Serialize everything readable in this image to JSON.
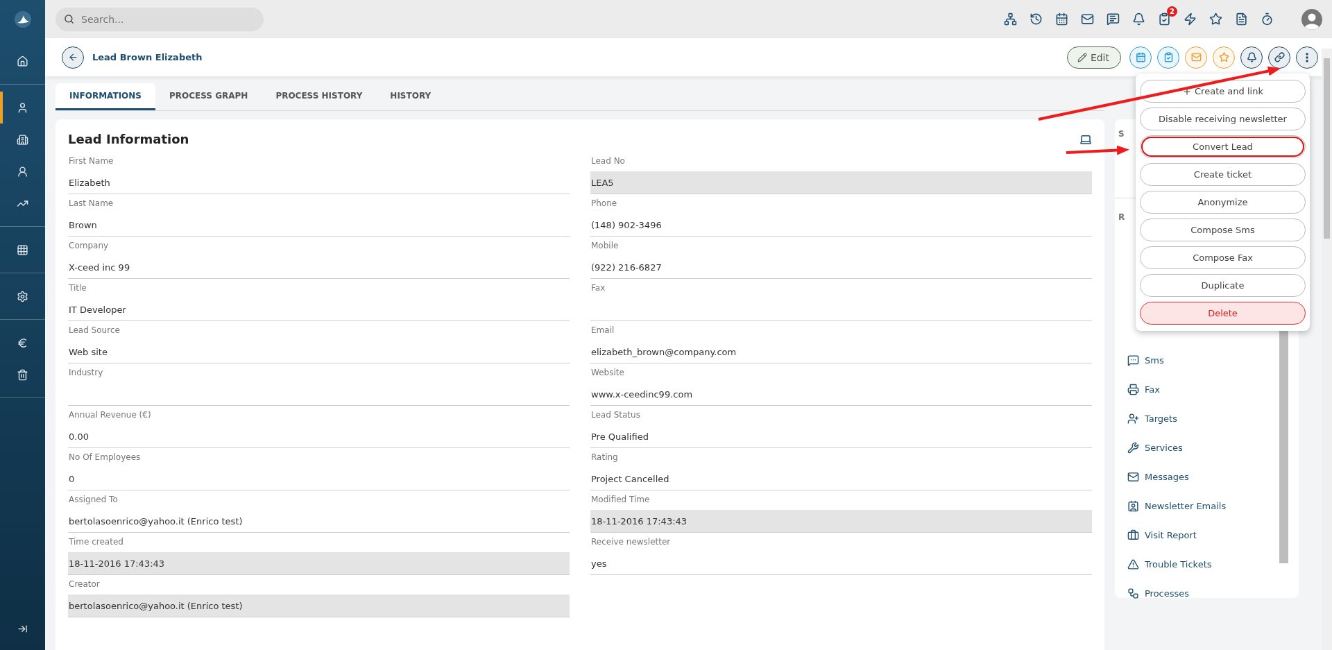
{
  "sidebar": {
    "groups": [
      [
        {
          "selected": false
        }
      ],
      [
        {
          "selected": true
        },
        {
          "selected": false
        },
        {
          "selected": false
        },
        {
          "selected": false
        }
      ],
      [
        {
          "selected": false
        }
      ],
      [
        {
          "selected": false
        }
      ],
      [
        {
          "selected": false
        },
        {
          "selected": false
        }
      ]
    ]
  },
  "search": {
    "placeholder": "Search..."
  },
  "toolbar": {
    "tasks_badge": "2"
  },
  "header": {
    "title": "Lead Brown Elizabeth",
    "edit": "Edit",
    "actions": [
      {
        "color": "#2a9fd6"
      },
      {
        "color": "#2a9fd6"
      },
      {
        "color": "#e8a23a"
      },
      {
        "color": "#e8a23a"
      },
      {
        "color": "#1d4e6e"
      },
      {
        "color": "#1d4e6e"
      },
      {
        "color": "#1d4e6e"
      }
    ]
  },
  "tabs": [
    {
      "label": "INFORMATIONS",
      "selected": true
    },
    {
      "label": "PROCESS GRAPH",
      "selected": false
    },
    {
      "label": "PROCESS HISTORY",
      "selected": false
    },
    {
      "label": "HISTORY",
      "selected": false
    }
  ],
  "card": {
    "title": "Lead Information",
    "left": [
      {
        "label": "First Name",
        "value": "Elizabeth",
        "readonly": false
      },
      {
        "label": "Last Name",
        "value": "Brown",
        "readonly": false
      },
      {
        "label": "Company",
        "value": "X-ceed inc 99",
        "readonly": false
      },
      {
        "label": "Title",
        "value": "IT Developer",
        "readonly": false
      },
      {
        "label": "Lead Source",
        "value": "Web site",
        "readonly": false
      },
      {
        "label": "Industry",
        "readonly": false
      },
      {
        "label": "Annual Revenue (€)",
        "value": "0.00",
        "readonly": false
      },
      {
        "label": "No Of Employees",
        "value": "0",
        "readonly": false
      },
      {
        "label": "Assigned To",
        "value": "bertolasoenrico@yahoo.it (Enrico test)",
        "readonly": false
      },
      {
        "label": "Time created",
        "value": "18-11-2016 17:43:43",
        "readonly": true
      },
      {
        "label": "Creator",
        "value": "bertolasoenrico@yahoo.it (Enrico test)",
        "readonly": true
      }
    ],
    "right": [
      {
        "label": "Lead No",
        "value": "LEA5",
        "readonly": true
      },
      {
        "label": "Phone",
        "value": "(148) 902-3496",
        "readonly": false
      },
      {
        "label": "Mobile",
        "value": "(922) 216-6827",
        "readonly": false
      },
      {
        "label": "Fax",
        "readonly": false
      },
      {
        "label": "Email",
        "value": "elizabeth_brown@company.com",
        "readonly": false
      },
      {
        "label": "Website",
        "value": "www.x-ceedinc99.com",
        "readonly": false
      },
      {
        "label": "Lead Status",
        "value": "Pre Qualified",
        "readonly": false
      },
      {
        "label": "Rating",
        "value": "Project Cancelled",
        "readonly": false
      },
      {
        "label": "Modified Time",
        "value": "18-11-2016 17:43:43",
        "readonly": true
      },
      {
        "label": "Receive newsletter",
        "value": "yes",
        "readonly": false
      }
    ]
  },
  "side_panel": {
    "heading_1": "S",
    "heading_2": "R",
    "related": [
      "Sms",
      "Fax",
      "Targets",
      "Services",
      "Messages",
      "Newsletter Emails",
      "Visit Report",
      "Trouble Tickets",
      "Processes"
    ]
  },
  "menu": [
    {
      "label": "Create and link",
      "kind": "add",
      "highlighted": false
    },
    {
      "label": "Disable receiving newsletter",
      "kind": "action",
      "highlighted": false
    },
    {
      "label": "Convert Lead",
      "kind": "action",
      "highlighted": true
    },
    {
      "label": "Create ticket",
      "kind": "action",
      "highlighted": false
    },
    {
      "label": "Anonymize",
      "kind": "action",
      "highlighted": false
    },
    {
      "label": "Compose Sms",
      "kind": "action",
      "highlighted": false
    },
    {
      "label": "Compose Fax",
      "kind": "action",
      "highlighted": false
    },
    {
      "label": "Duplicate",
      "kind": "action",
      "highlighted": false
    },
    {
      "label": "Delete",
      "kind": "danger",
      "highlighted": false
    }
  ]
}
